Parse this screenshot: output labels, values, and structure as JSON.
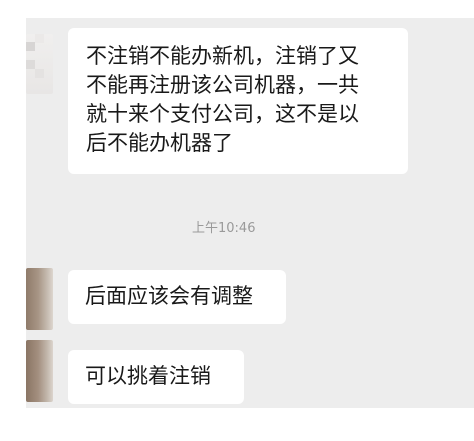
{
  "chat": {
    "messages": [
      {
        "sender": "other",
        "lines": [
          "不注销不能办新机，注销了又",
          "不能再注册该公司机器，一共",
          "就十来个支付公司，这不是以",
          "后不能办机器了"
        ]
      },
      {
        "sender": "other",
        "text": "后面应该会有调整"
      },
      {
        "sender": "other",
        "text": "可以挑着注销"
      }
    ],
    "timestamp": "上午10:46"
  }
}
